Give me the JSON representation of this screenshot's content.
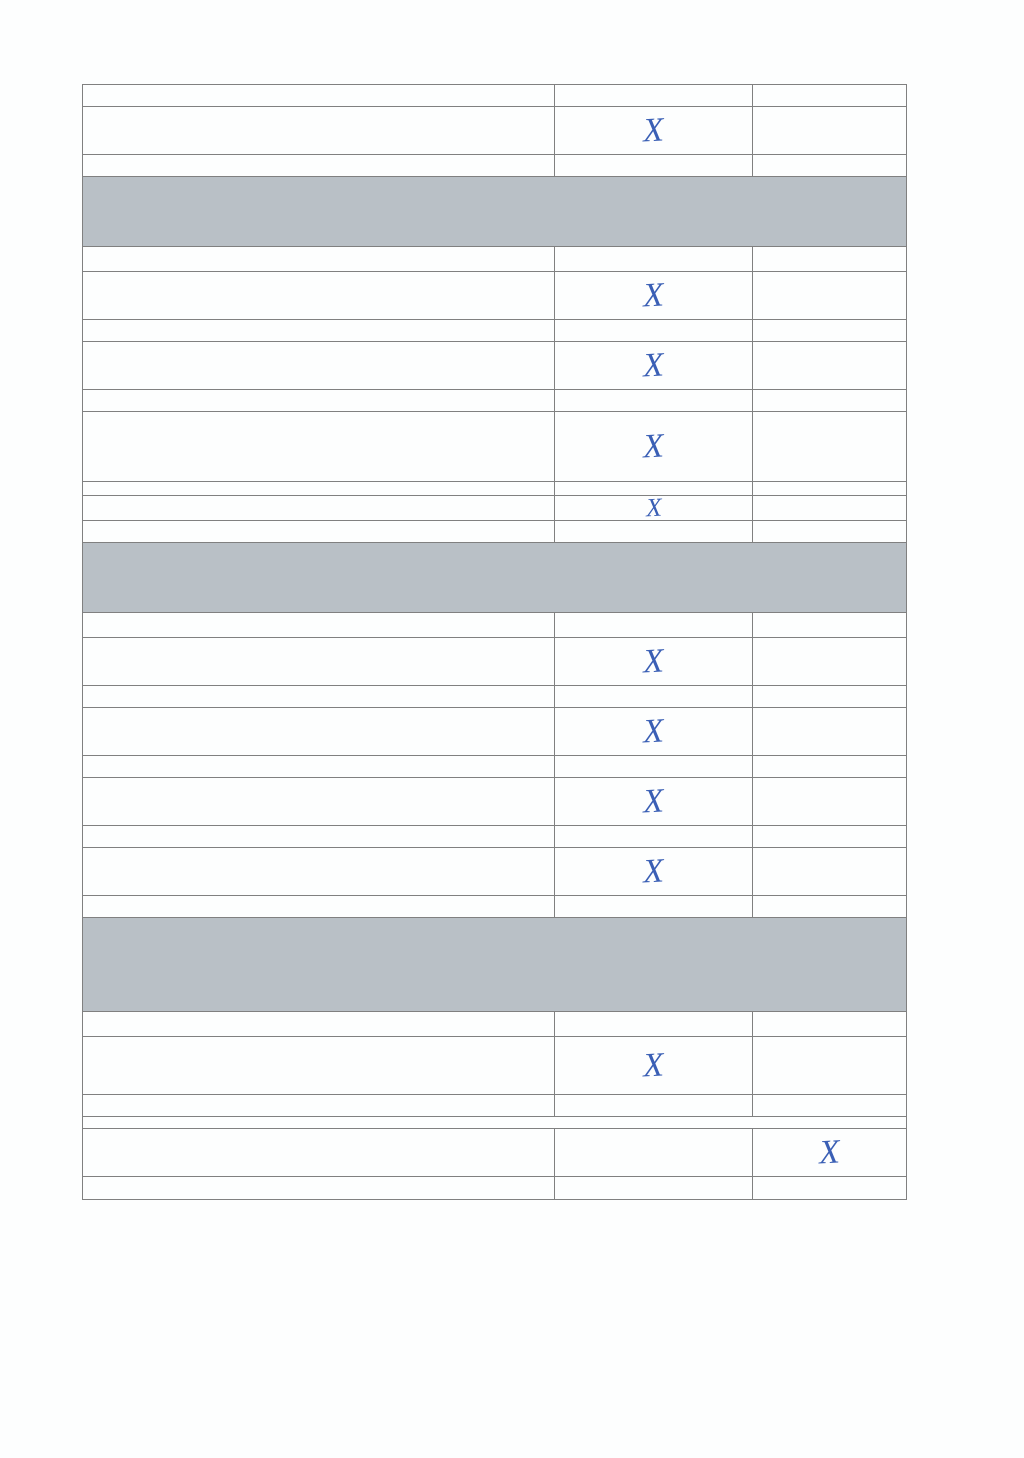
{
  "marks": {
    "section1": {
      "row1_col2": "X"
    },
    "section2": {
      "row2_col2": "X",
      "row3_col2": "X",
      "row4_col2": "X",
      "row5_col2": "X"
    },
    "section3": {
      "row2_col2": "X",
      "row3_col2": "X",
      "row4_col2": "X",
      "row5_col2": "X"
    },
    "section4": {
      "row2_col2": "X",
      "row3_col3": "X"
    }
  }
}
